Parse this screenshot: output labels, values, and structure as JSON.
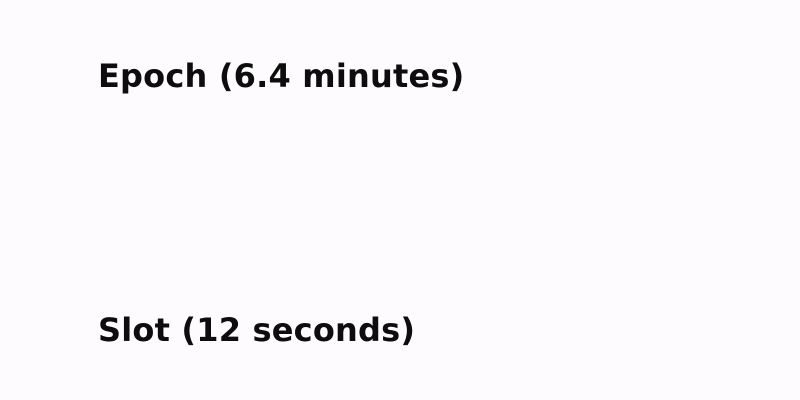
{
  "labels": {
    "epoch": "Epoch (6.4 minutes)",
    "slot": "Slot (12 seconds)"
  },
  "colors": {
    "background": "#fdfbfd",
    "text": "#0d0d0d"
  }
}
